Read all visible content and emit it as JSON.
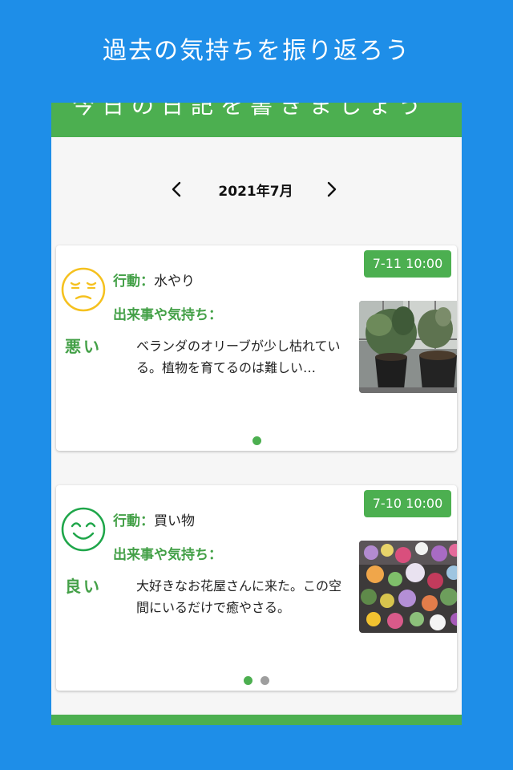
{
  "promo": {
    "title": "過去の気持ちを振り返ろう"
  },
  "app_bar": {
    "title": "今日の日記を書きましょう"
  },
  "month_nav": {
    "label": "2021年7月",
    "prev_icon": "chevron-left-icon",
    "next_icon": "chevron-right-icon"
  },
  "entries": [
    {
      "date": "7-11 10:00",
      "mood": "悪い",
      "mood_icon": "sad-face-icon",
      "mood_color": "#f5c11f",
      "action_key": "行動：",
      "action_value": "水やり",
      "feel_label": "出来事や気持ち：",
      "text": "ベランダのオリーブが少し枯れている。植物を育てるのは難しい…",
      "dots": [
        "active"
      ]
    },
    {
      "date": "7-10 10:00",
      "mood": "良い",
      "mood_icon": "happy-face-icon",
      "mood_color": "#1fa64a",
      "action_key": "行動：",
      "action_value": "買い物",
      "feel_label": "出来事や気持ち：",
      "text": "大好きなお花屋さんに来た。この空間にいるだけで癒やさる。",
      "dots": [
        "active",
        "inactive"
      ]
    }
  ],
  "colors": {
    "background": "#1e8ee8",
    "accent": "#4caf50"
  }
}
